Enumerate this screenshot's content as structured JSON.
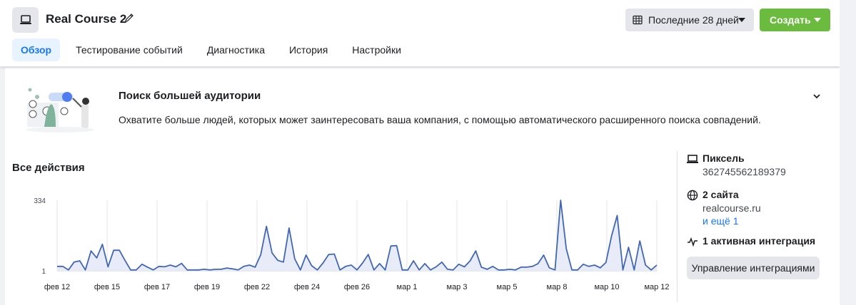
{
  "header": {
    "title": "Real Course 2",
    "date_range": "Последние 28 дней",
    "create_label": "Создать",
    "icons": {
      "app": "laptop-icon",
      "edit": "pencil-icon",
      "calendar": "calendar-icon"
    }
  },
  "tabs": [
    {
      "label": "Обзор",
      "active": true
    },
    {
      "label": "Тестирование событий",
      "active": false
    },
    {
      "label": "Диагностика",
      "active": false
    },
    {
      "label": "История",
      "active": false
    },
    {
      "label": "Настройки",
      "active": false
    }
  ],
  "banner": {
    "title": "Поиск большей аудитории",
    "text": "Охватите больше людей, которых может заинтересовать ваша компания, с помощью автоматического расширенного поиска совпадений."
  },
  "section": {
    "title": "Все действия"
  },
  "sidebar": {
    "pixel_label": "Пиксель",
    "pixel_id": "362745562189379",
    "sites_label": "2 сайта",
    "site": "realcourse.ru",
    "more_link": "и ещё 1",
    "integration_label": "1 активная интеграция",
    "manage_button": "Управление интеграциями"
  },
  "colors": {
    "accent": "#1877f2",
    "create_green": "#6abb3e",
    "line": "#4267b2",
    "fill": "#e8ecf8"
  },
  "chart_data": {
    "type": "area",
    "ylim": [
      1,
      334
    ],
    "yticks": [
      "1",
      "334"
    ],
    "xticks": [
      "фев 12",
      "фев 15",
      "фев 17",
      "фев 19",
      "фев 22",
      "фев 24",
      "фев 26",
      "мар 1",
      "мар 3",
      "мар 5",
      "мар 8",
      "мар 10",
      "мар 12"
    ],
    "values": [
      22,
      22,
      5,
      42,
      48,
      5,
      95,
      62,
      126,
      20,
      98,
      98,
      50,
      5,
      5,
      32,
      18,
      5,
      22,
      20,
      28,
      20,
      36,
      5,
      5,
      5,
      8,
      5,
      8,
      8,
      14,
      10,
      5,
      22,
      28,
      18,
      78,
      211,
      85,
      50,
      42,
      203,
      58,
      5,
      75,
      25,
      5,
      38,
      78,
      80,
      5,
      22,
      28,
      5,
      38,
      78,
      5,
      35,
      5,
      118,
      120,
      5,
      5,
      48,
      5,
      35,
      5,
      20,
      42,
      8,
      5,
      32,
      20,
      48,
      95,
      18,
      8,
      22,
      5,
      5,
      8,
      5,
      18,
      18,
      22,
      35,
      75,
      15,
      5,
      334,
      105,
      5,
      5,
      32,
      22,
      28,
      15,
      40,
      165,
      262,
      5,
      112,
      5,
      142,
      28,
      5,
      28
    ]
  }
}
